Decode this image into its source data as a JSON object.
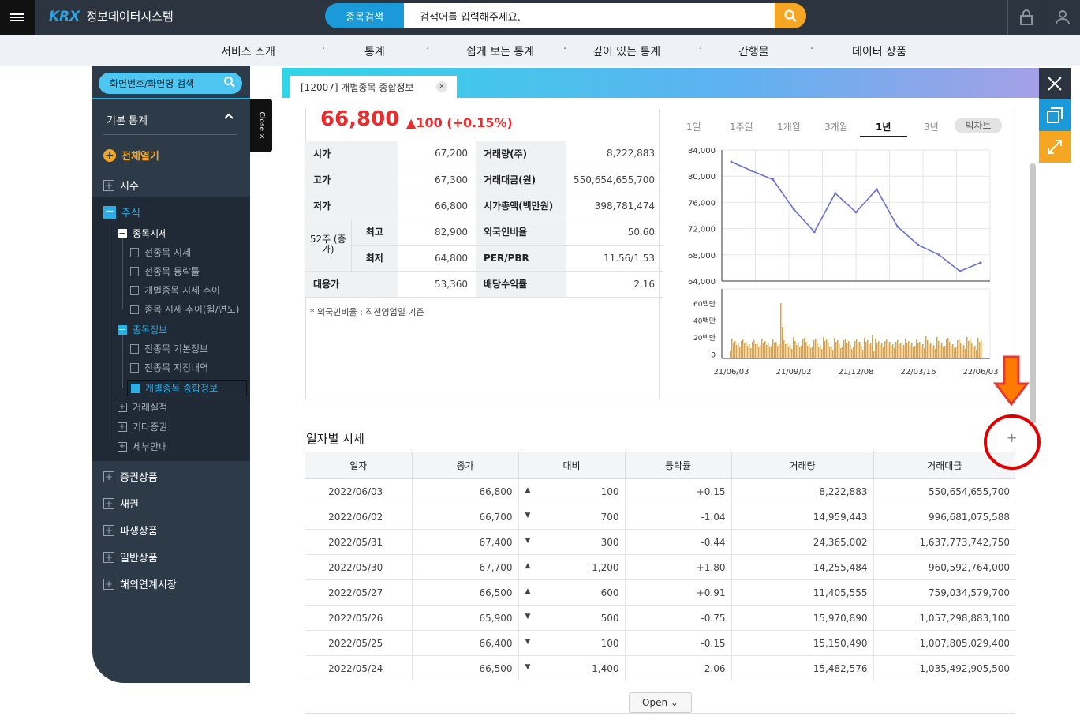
{
  "header": {
    "logo": "KRX",
    "system_name": "정보데이터시스템",
    "search_type": "종목검색",
    "search_placeholder": "검색어를 입력해주세요."
  },
  "nav": {
    "items": [
      "서비스 소개",
      "통계",
      "쉽게 보는 통계",
      "깊이 있는 통계",
      "간행물",
      "데이터 상품"
    ],
    "separator": "·"
  },
  "sidebar": {
    "search_label": "화면번호/화면명 검색",
    "header": "기본 통계",
    "expand_all": "전체열기",
    "index": "지수",
    "stock": "주식",
    "stock_price": "종목시세",
    "stock_price_items": [
      "전종목 시세",
      "전종목 등락률",
      "개별종목 시세 추이",
      "종목 시세 추이(월/연도)"
    ],
    "stock_info": "종목정보",
    "stock_info_items": [
      "전종목 기본정보",
      "전종목 지정내역",
      "개별종목 종합정보"
    ],
    "more_items": [
      "거래실적",
      "기타증권",
      "세부안내"
    ],
    "categories": [
      "증권상품",
      "채권",
      "파생상품",
      "일반상품",
      "해외연계시장"
    ],
    "close_label": "Close ×"
  },
  "tab": {
    "label": "[12007] 개별종목 종합정보",
    "close": "×"
  },
  "quote": {
    "price": "66,800",
    "change": "▲100 (+0.15%)",
    "rows": [
      {
        "l1": "시가",
        "v1": "67,200",
        "l2": "거래량(주)",
        "v2": "8,222,883"
      },
      {
        "l1": "고가",
        "v1": "67,300",
        "l2": "거래대금(원)",
        "v2": "550,654,655,700"
      },
      {
        "l1": "저가",
        "v1": "66,800",
        "l2": "시가총액(백만원)",
        "v2": "398,781,474"
      },
      {
        "l1": "최고",
        "v1": "82,900",
        "l2": "외국인비율",
        "v2": "50.60"
      },
      {
        "l1": "최저",
        "v1": "64,800",
        "l2": "PER/PBR",
        "v2": "11.56/1.53"
      },
      {
        "l1": "대용가",
        "v1": "53,360",
        "l2": "배당수익률",
        "v2": "2.16"
      }
    ],
    "week52": "52주 (종가)",
    "note": "* 외국인비율 : 직전영업일 기준"
  },
  "periods": {
    "items": [
      "1일",
      "1주일",
      "1개월",
      "3개월",
      "1년",
      "3년"
    ],
    "active": "1년",
    "bigchart": "빅차트"
  },
  "chart_data": {
    "type": "line",
    "x": [
      "21/06/03",
      "21/07/01",
      "21/08/02",
      "21/09/02",
      "21/10/01",
      "21/11/01",
      "21/12/08",
      "22/01/03",
      "22/02/03",
      "22/03/16",
      "22/04/15",
      "22/05/16",
      "22/06/03"
    ],
    "series": [
      {
        "values": [
          82200,
          80800,
          79500,
          75000,
          71500,
          77400,
          74500,
          78000,
          72300,
          69500,
          68000,
          65500,
          66800
        ]
      }
    ],
    "ylim": [
      64000,
      84000
    ],
    "yticks": [
      "84,000",
      "80,000",
      "76,000",
      "72,000",
      "68,000",
      "64,000"
    ],
    "volume_ticks": [
      "60백만",
      "40백만",
      "20백만",
      "0"
    ],
    "xticks": [
      "21/06/03",
      "21/09/02",
      "21/12/08",
      "22/03/16",
      "22/06/03"
    ],
    "colors": {
      "line": "#6b6fd3",
      "volume": "#f0a020"
    },
    "grid": true
  },
  "daily": {
    "title": "일자별 시세",
    "plus": "+",
    "columns": [
      "일자",
      "종가",
      "대비",
      "등락률",
      "거래량",
      "거래대금"
    ],
    "rows": [
      {
        "date": "2022/06/03",
        "close": "66,800",
        "dir": "up",
        "diff": "100",
        "rate": "+0.15",
        "vol": "8,222,883",
        "amt": "550,654,655,700"
      },
      {
        "date": "2022/06/02",
        "close": "66,700",
        "dir": "dn",
        "diff": "700",
        "rate": "-1.04",
        "vol": "14,959,443",
        "amt": "996,681,075,588"
      },
      {
        "date": "2022/05/31",
        "close": "67,400",
        "dir": "dn",
        "diff": "300",
        "rate": "-0.44",
        "vol": "24,365,002",
        "amt": "1,637,773,742,750"
      },
      {
        "date": "2022/05/30",
        "close": "67,700",
        "dir": "up",
        "diff": "1,200",
        "rate": "+1.80",
        "vol": "14,255,484",
        "amt": "960,592,764,000"
      },
      {
        "date": "2022/05/27",
        "close": "66,500",
        "dir": "up",
        "diff": "600",
        "rate": "+0.91",
        "vol": "11,405,555",
        "amt": "759,034,579,700"
      },
      {
        "date": "2022/05/26",
        "close": "65,900",
        "dir": "dn",
        "diff": "500",
        "rate": "-0.75",
        "vol": "15,970,890",
        "amt": "1,057,298,883,100"
      },
      {
        "date": "2022/05/25",
        "close": "66,400",
        "dir": "dn",
        "diff": "100",
        "rate": "-0.15",
        "vol": "15,150,490",
        "amt": "1,007,805,029,400"
      },
      {
        "date": "2022/05/24",
        "close": "66,500",
        "dir": "dn",
        "diff": "1,400",
        "rate": "-2.06",
        "vol": "15,482,576",
        "amt": "1,035,492,905,500"
      }
    ],
    "open_label": "Open ⌄"
  }
}
